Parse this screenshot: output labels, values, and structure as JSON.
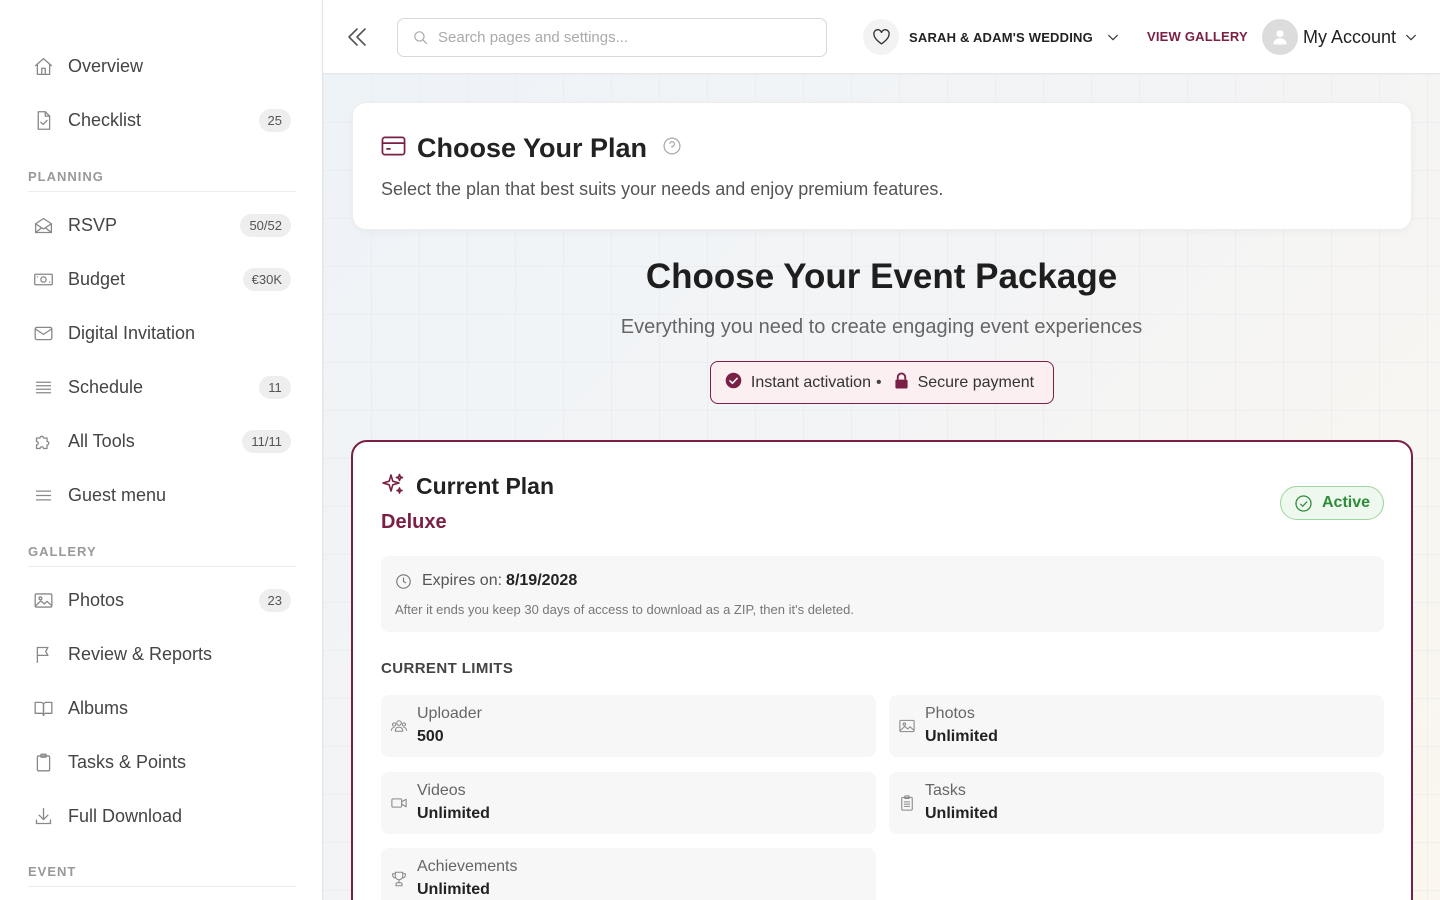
{
  "sidebar": {
    "items": [
      {
        "label": "Overview",
        "badge": ""
      },
      {
        "label": "Checklist",
        "badge": "25"
      },
      {
        "label": "RSVP",
        "badge": "50/52"
      },
      {
        "label": "Budget",
        "badge": "€30K"
      },
      {
        "label": "Digital Invitation",
        "badge": ""
      },
      {
        "label": "Schedule",
        "badge": "11"
      },
      {
        "label": "All Tools",
        "badge": "11/11"
      },
      {
        "label": "Guest menu",
        "badge": ""
      },
      {
        "label": "Photos",
        "badge": "23"
      },
      {
        "label": "Review & Reports",
        "badge": ""
      },
      {
        "label": "Albums",
        "badge": ""
      },
      {
        "label": "Tasks & Points",
        "badge": ""
      },
      {
        "label": "Full Download",
        "badge": ""
      }
    ],
    "sections": {
      "planning": "PLANNING",
      "gallery": "GALLERY",
      "event": "EVENT"
    }
  },
  "header": {
    "search_placeholder": "Search pages and settings...",
    "event_name": "SARAH & ADAM'S WEDDING",
    "view_gallery": "VIEW GALLERY",
    "account_label": "My Account"
  },
  "page": {
    "title": "Choose Your Plan",
    "subtitle": "Select the plan that best suits your needs and enjoy premium features.",
    "package_title": "Choose Your Event Package",
    "package_subtitle": "Everything you need to create engaging event experiences",
    "pill": {
      "instant": "Instant activation",
      "separator": "•",
      "secure": "Secure payment"
    }
  },
  "current_plan": {
    "heading": "Current Plan",
    "plan_name": "Deluxe",
    "status": "Active",
    "expires_label": "Expires on:",
    "expires_value": "8/19/2028",
    "expiry_note": "After it ends you keep 30 days of access to download as a ZIP, then it's deleted.",
    "limits_title": "CURRENT LIMITS",
    "limits": [
      {
        "label": "Uploader",
        "value": "500"
      },
      {
        "label": "Photos",
        "value": "Unlimited"
      },
      {
        "label": "Videos",
        "value": "Unlimited"
      },
      {
        "label": "Tasks",
        "value": "Unlimited"
      },
      {
        "label": "Achievements",
        "value": "Unlimited"
      }
    ]
  },
  "colors": {
    "accent": "#7a1f45",
    "active_green": "#2e8b3a"
  },
  "icons": {
    "sidebar": [
      "home-icon",
      "file-check-icon",
      "envelope-open-icon",
      "banknote-icon",
      "mail-icon",
      "list-icon",
      "puzzle-icon",
      "menu-icon",
      "image-icon",
      "flag-icon",
      "book-icon",
      "clipboard-icon",
      "download-icon"
    ]
  }
}
